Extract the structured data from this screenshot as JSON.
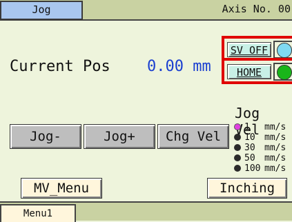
{
  "header": {
    "tab_label": "Jog",
    "axis_label": "Axis No. 00"
  },
  "position": {
    "label": "Current Pos",
    "value": "0.00 mm"
  },
  "servo": {
    "button_label": "SV OFF",
    "lamp_color": "#7fd9f2"
  },
  "home": {
    "button_label": "HOME",
    "lamp_color": "#19b51a"
  },
  "jog_velocity": {
    "title": "Jog Vel",
    "options": [
      {
        "value": "1",
        "unit": "mm/s",
        "selected": true
      },
      {
        "value": "10",
        "unit": "mm/s",
        "selected": false
      },
      {
        "value": "30",
        "unit": "mm/s",
        "selected": false
      },
      {
        "value": "50",
        "unit": "mm/s",
        "selected": false
      },
      {
        "value": "100",
        "unit": "mm/s",
        "selected": false
      }
    ]
  },
  "buttons": {
    "jog_minus": "Jog-",
    "jog_plus": "Jog+",
    "change_velocity": "Chg Vel",
    "mv_menu": "MV_Menu",
    "inching": "Inching"
  },
  "footer": {
    "menu_tab": "Menu1"
  },
  "colors": {
    "background": "#eef4dc",
    "bar": "#c9d2a2",
    "highlight_border": "#e00000",
    "value_text": "#1a3fd0"
  }
}
